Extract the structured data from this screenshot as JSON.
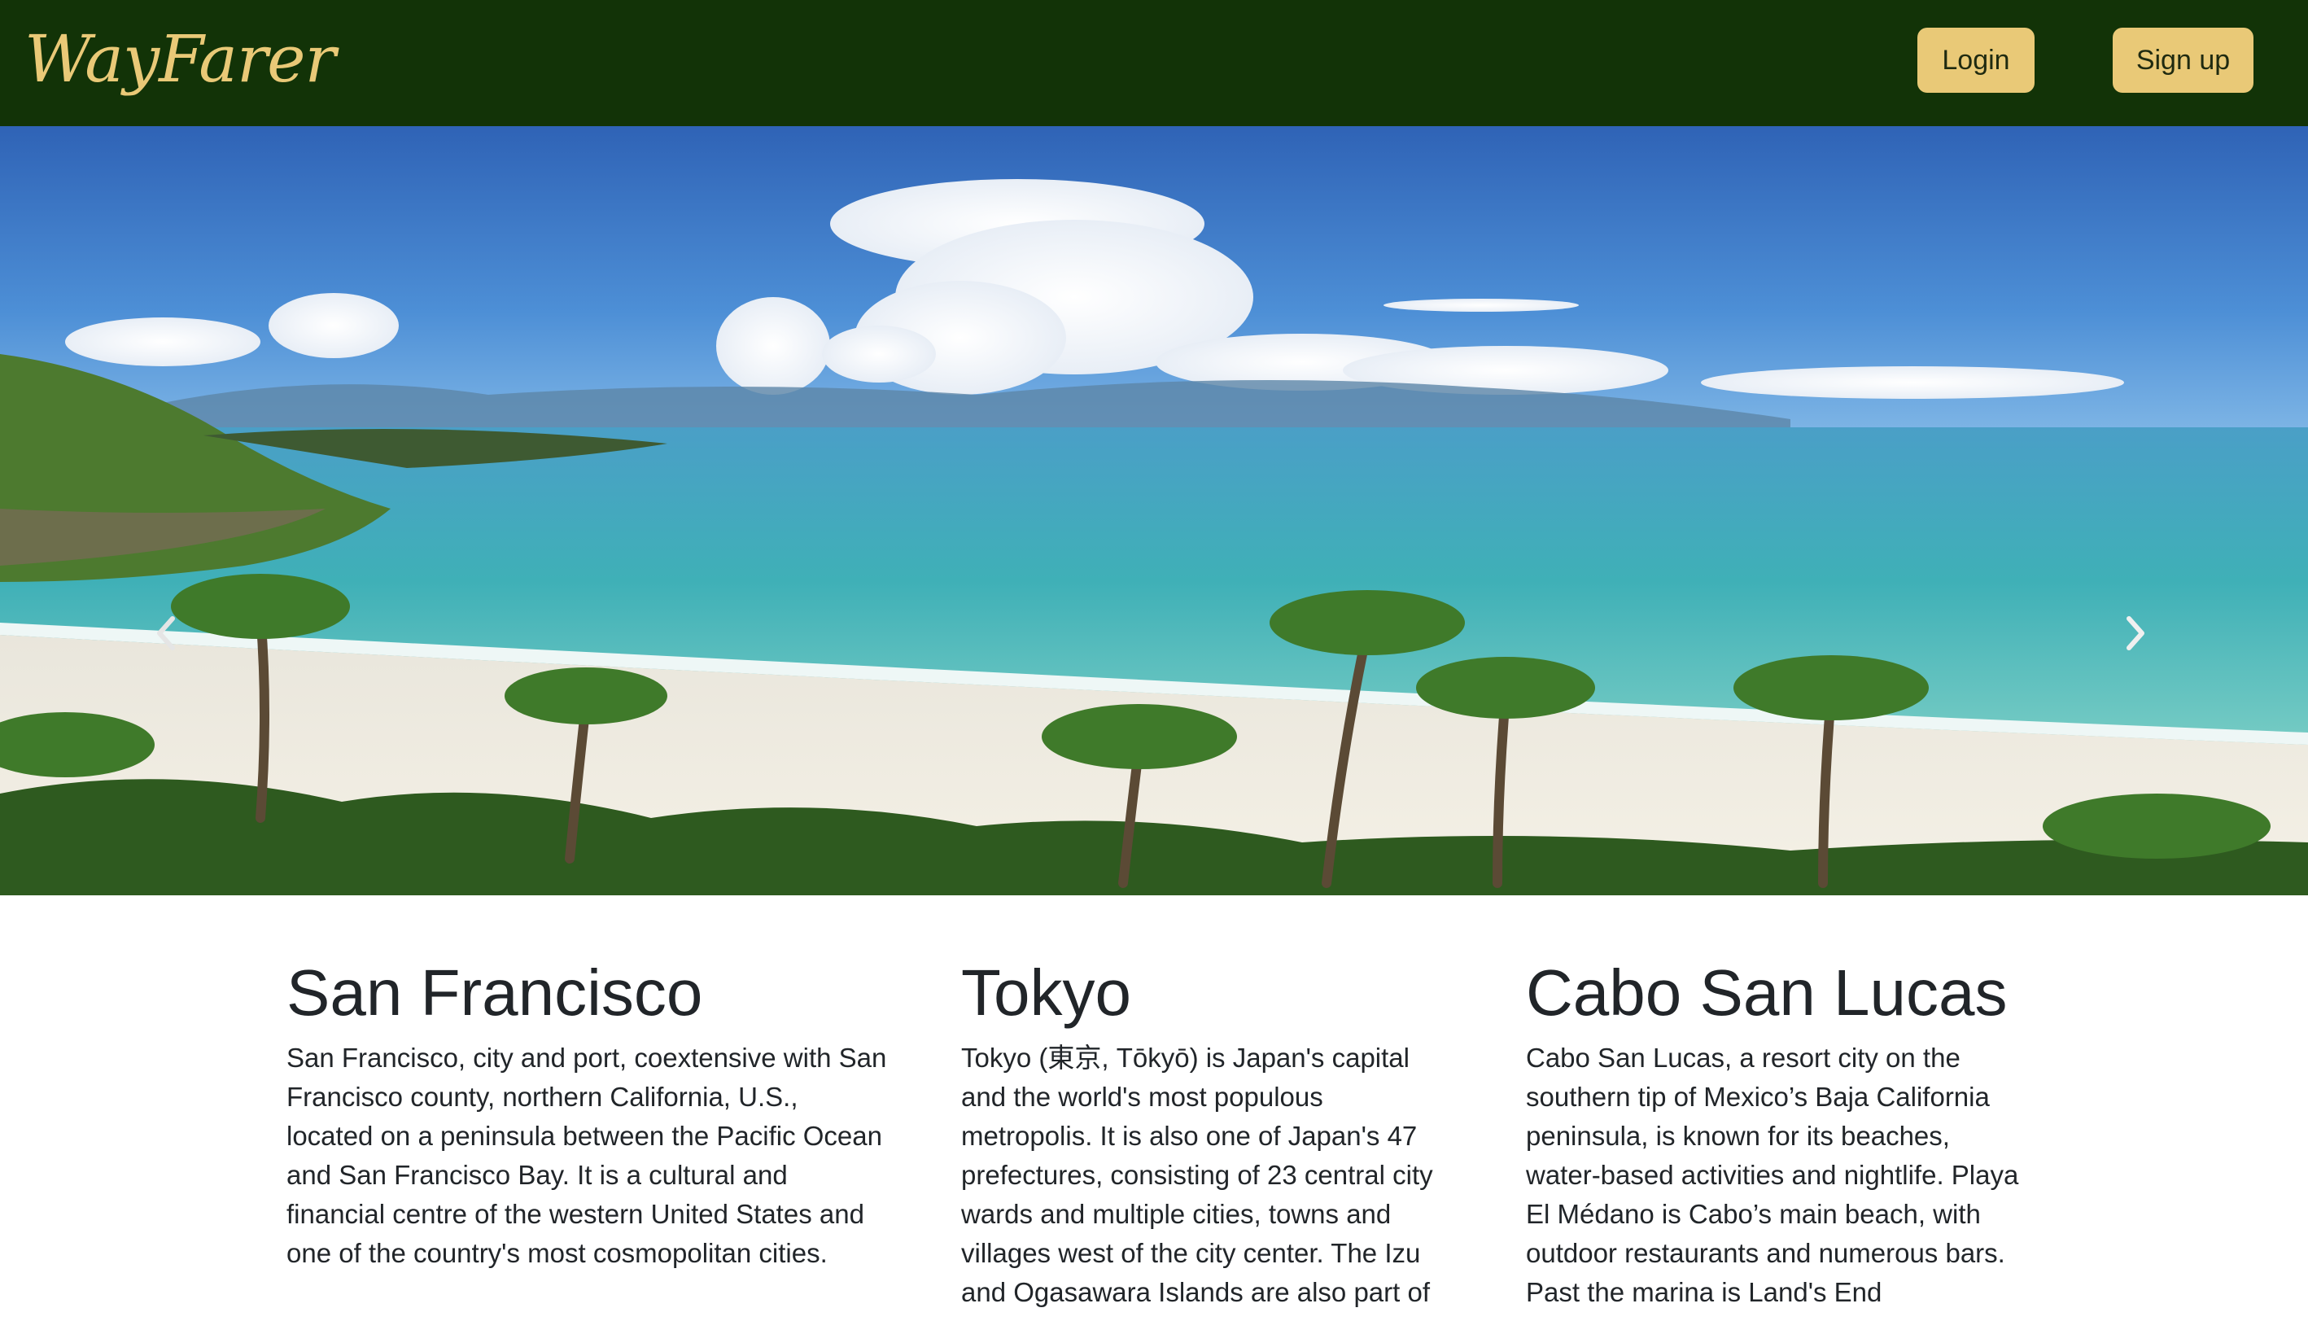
{
  "navbar": {
    "brand": "WayFarer",
    "login_label": "Login",
    "signup_label": "Sign up"
  },
  "carousel": {
    "prev_icon": "chevron-left-icon",
    "next_icon": "chevron-right-icon"
  },
  "cities": [
    {
      "name": "San Francisco",
      "description": "San Francisco, city and port, coextensive with San Francisco county, northern California, U.S., located on a peninsula between the Pacific Ocean and San Francisco Bay. It is a cultural and financial centre of the western United States and one of the country's most cosmopolitan cities."
    },
    {
      "name": "Tokyo",
      "description": "Tokyo (東京, Tōkyō) is Japan's capital and the world's most populous metropolis. It is also one of Japan's 47 prefectures, consisting of 23 central city wards and multiple cities, towns and villages west of the city center. The Izu and Ogasawara Islands are also part of"
    },
    {
      "name": "Cabo San Lucas",
      "description": "Cabo San Lucas, a resort city on the southern tip of Mexico’s Baja California peninsula, is known for its beaches, water-based activities and nightlife. Playa El Médano is Cabo’s main beach, with outdoor restaurants and numerous bars. Past the marina is Land's End"
    }
  ],
  "colors": {
    "navbar_bg": "#123307",
    "accent": "#e9c977",
    "text": "#212529"
  }
}
